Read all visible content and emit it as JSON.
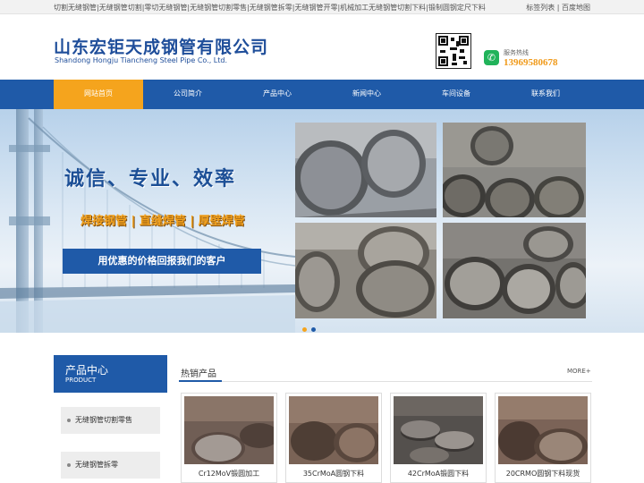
{
  "topbar": {
    "keywords": "切割无缝钢管|无缝钢管切割|零切无缝钢管|无缝钢管切割零售|无缝钢管拆零|无缝钢管开零|机械加工无缝钢管切割下料|锻制圆钢定尺下料",
    "link_sitemap_tags": "标签列表",
    "separator": " | ",
    "link_baidu_map": "百度地图"
  },
  "header": {
    "company_cn": "山东宏钜天成钢管有限公司",
    "company_en": "Shandong Hongju Tiancheng Steel Pipe Co., Ltd.",
    "hotline_label": "服务热线",
    "hotline_number": "13969580678"
  },
  "nav": {
    "items": [
      {
        "label": "网站首页",
        "active": true
      },
      {
        "label": "公司简介",
        "active": false
      },
      {
        "label": "产品中心",
        "active": false
      },
      {
        "label": "新闻中心",
        "active": false
      },
      {
        "label": "车间设备",
        "active": false
      },
      {
        "label": "联系我们",
        "active": false
      }
    ]
  },
  "banner": {
    "slogan": "诚信、专业、效率",
    "sub_slogan": "焊接钢管 | 直缝焊管 | 厚壁焊管",
    "button_text": "用优惠的价格回报我们的客户",
    "slides_total": 2,
    "active_slide": 1
  },
  "sidebar": {
    "title_cn": "产品中心",
    "title_en": "PRODUCT",
    "items": [
      {
        "label": "无缝钢管切割零售"
      },
      {
        "label": "无缝钢管拆零"
      }
    ]
  },
  "hot_products": {
    "title": "热销产品",
    "more": "MORE+",
    "cards": [
      {
        "caption": "Cr12MoV锻圆加工"
      },
      {
        "caption": "35CrMoA圆钢下料"
      },
      {
        "caption": "42CrMoA锻圆下料"
      },
      {
        "caption": "20CRMO圆钢下料现货"
      }
    ]
  },
  "colors": {
    "brand_blue": "#1f5aa8",
    "accent_orange": "#f5a41d",
    "hotline_green": "#21b35a"
  }
}
